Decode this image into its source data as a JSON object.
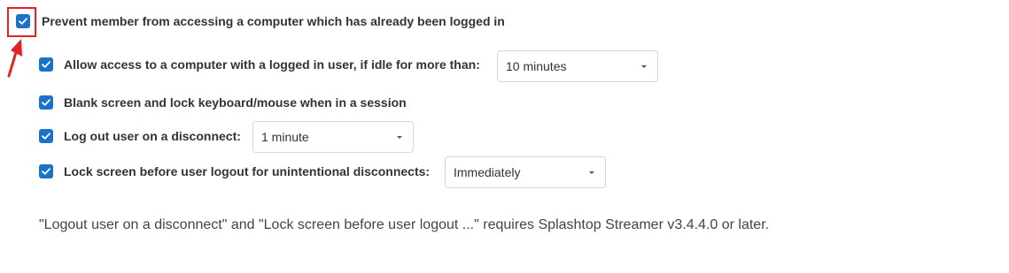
{
  "settings": {
    "prevent_access": {
      "label": "Prevent member from accessing a computer which has already been logged in",
      "checked": true
    },
    "allow_idle": {
      "label": "Allow access to a computer with a logged in user, if idle for more than:",
      "checked": true,
      "selected": "10 minutes"
    },
    "blank_screen": {
      "label": "Blank screen and lock keyboard/mouse when in a session",
      "checked": true
    },
    "logout_disconnect": {
      "label": "Log out user on a disconnect:",
      "checked": true,
      "selected": "1 minute"
    },
    "lock_screen": {
      "label": "Lock screen before user logout for unintentional disconnects:",
      "checked": true,
      "selected": "Immediately"
    }
  },
  "note": "\"Logout user on a disconnect\" and \"Lock screen before user logout ...\" requires Splashtop Streamer v3.4.4.0 or later.",
  "colors": {
    "checkbox": "#1a73c9",
    "highlight": "#e02424",
    "text": "#333333"
  },
  "icons": {
    "check": "check-icon",
    "caret": "caret-down-icon",
    "arrow": "red-arrow-icon"
  }
}
